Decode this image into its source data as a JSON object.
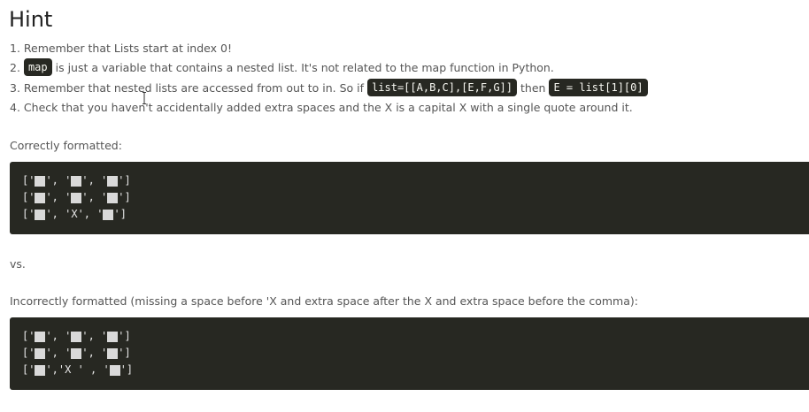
{
  "title": "Hint",
  "hints": [
    {
      "num": "1.",
      "text": "Remember that Lists start at index 0!"
    },
    {
      "num": "2.",
      "code": "map",
      "text": "is just a variable that contains a nested list. It's not related to the map function in Python."
    },
    {
      "num": "3.",
      "text": "Remember that nested lists are accessed from out to in. So if",
      "code1": "list=[[A,B,C],[E,F,G]]",
      "mid": "then",
      "code2": "E = list[1][0]"
    },
    {
      "num": "4.",
      "text": "Check that you haven't accidentally added extra spaces and the X is a capital X with a single quote around it."
    }
  ],
  "correct_label": "Correctly formatted:",
  "correct_rows": [
    [
      "['",
      "', '",
      "', '",
      "']"
    ],
    [
      "['",
      "', '",
      "', '",
      "']"
    ],
    [
      "['",
      "', 'X', '",
      "']"
    ]
  ],
  "vs_label": "vs.",
  "incorrect_label": "Incorrectly formatted (missing a space before 'X and extra space after the X and extra space before the comma):",
  "incorrect_rows": [
    [
      "['",
      "', '",
      "', '",
      "']"
    ],
    [
      "['",
      "', '",
      "', '",
      "']"
    ],
    [
      "['",
      "','X ' , '",
      "']"
    ]
  ]
}
